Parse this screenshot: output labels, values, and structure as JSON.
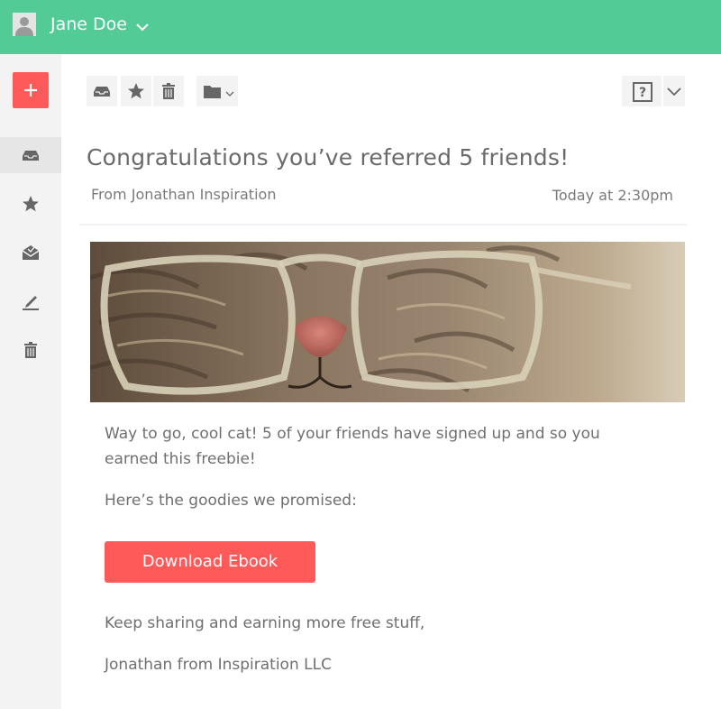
{
  "header": {
    "user_name": "Jane Doe",
    "bg_color": "#52cb96",
    "avatar_icon": "user-icon",
    "menu_icon": "chevron-down-icon"
  },
  "sidebar": {
    "compose_icon": "plus-icon",
    "compose_color": "#ff5a5a",
    "items": [
      {
        "icon": "inbox-icon",
        "active": true
      },
      {
        "icon": "star-icon",
        "active": false
      },
      {
        "icon": "envelope-open-icon",
        "active": false
      },
      {
        "icon": "pencil-icon",
        "active": false
      },
      {
        "icon": "trash-icon",
        "active": false
      }
    ]
  },
  "toolbar": {
    "actions": [
      "inbox-icon",
      "star-icon",
      "trash-icon",
      "folder-icon"
    ],
    "help_icon": "help-icon",
    "more_icon": "chevron-down-icon"
  },
  "email": {
    "subject": "Congratulations you’ve referred 5 friends!",
    "from": "From Jonathan Inspiration",
    "time": "Today at 2:30pm",
    "paragraph1": "Way to go, cool cat! 5 of your friends have signed up and so you earned this freebie!",
    "paragraph2": "Here’s the goodies we promised:",
    "button_label": "Download Ebook",
    "paragraph3": "Keep sharing and earning more free stuff,",
    "signature": "Jonathan from Inspiration LLC"
  }
}
